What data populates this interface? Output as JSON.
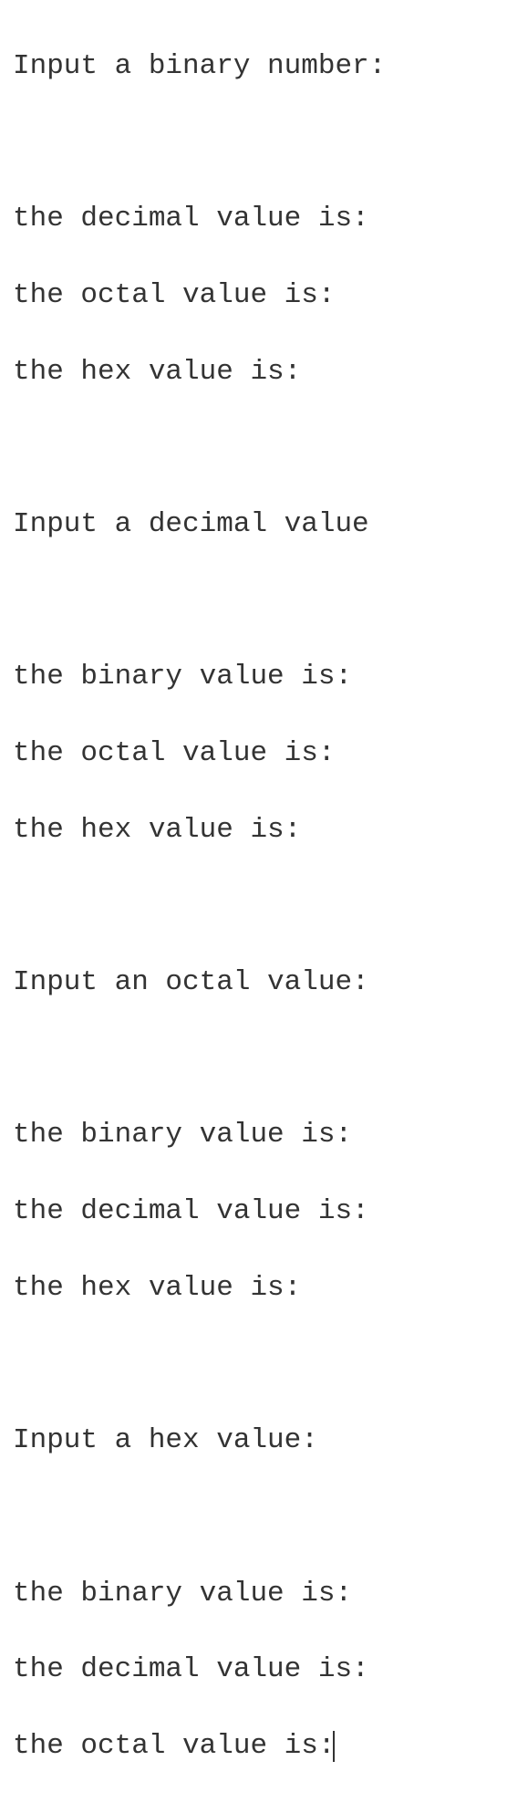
{
  "block1": {
    "prompt": "Input a binary number:",
    "out1": "the decimal value is:",
    "out2": "the octal value is:",
    "out3": "the hex value is:"
  },
  "block2": {
    "prompt": "Input a decimal value",
    "out1": "the binary value is:",
    "out2": "the octal value is:",
    "out3": "the hex value is:"
  },
  "block3": {
    "prompt": "Input an octal value:",
    "out1": "the binary value is:",
    "out2": "the decimal value is:",
    "out3": "the hex value is:"
  },
  "block4": {
    "prompt": "Input a hex value:",
    "out1": "the binary value is:",
    "out2": "the decimal value is:",
    "out3": "the octal value is:"
  }
}
